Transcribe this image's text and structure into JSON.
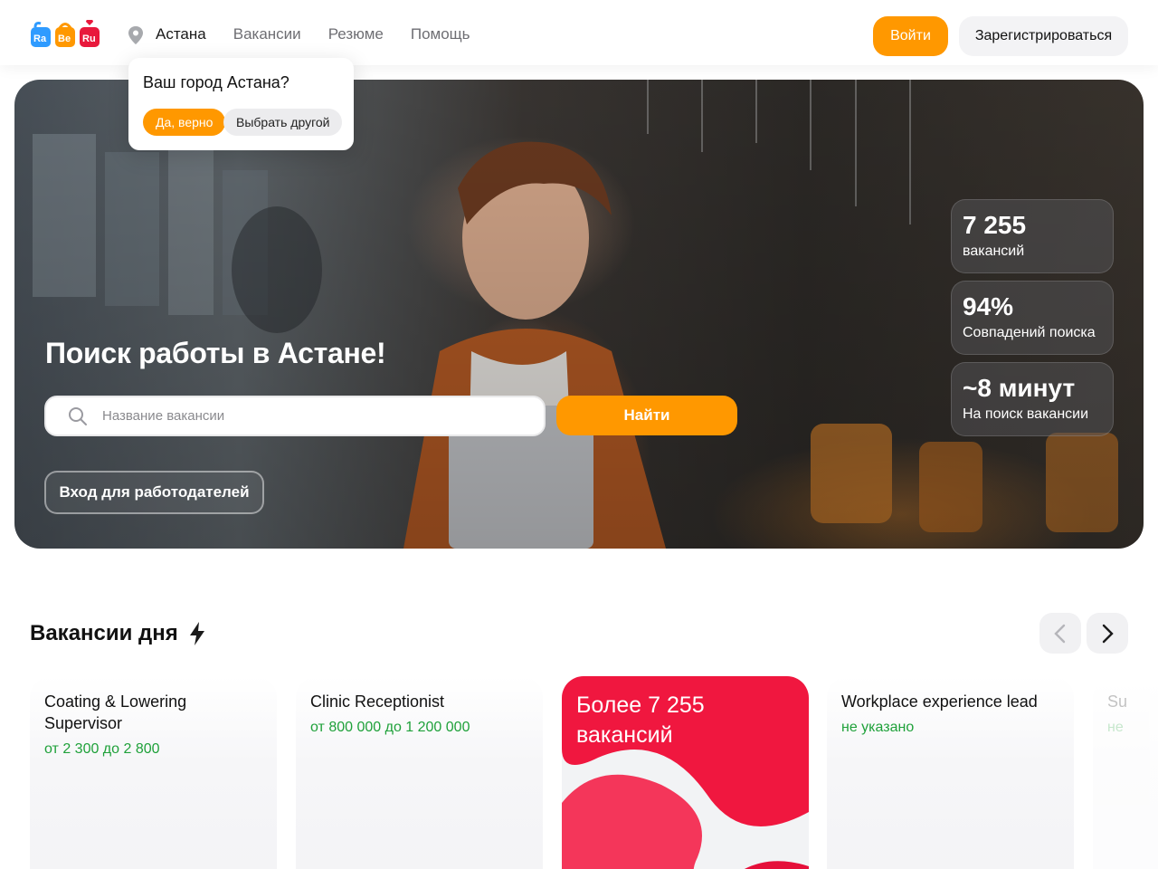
{
  "header": {
    "logo": {
      "parts": [
        "Ra",
        "Be",
        "Ru"
      ],
      "colors": [
        "#2f9bff",
        "#ff9800",
        "#e8193c"
      ]
    },
    "location_icon": "map-pin-icon",
    "nav": [
      "Астана",
      "Вакансии",
      "Резюме",
      "Помощь"
    ],
    "login_label": "Войти",
    "register_label": "Зарегистрироваться"
  },
  "city_popup": {
    "question": "Ваш город Астана?",
    "confirm_label": "Да, верно",
    "choose_label": "Выбрать другой"
  },
  "hero": {
    "title": "Поиск работы в Астане!",
    "search_placeholder": "Название вакансии",
    "search_icon": "search-icon",
    "find_label": "Найти",
    "employer_label": "Вход для работодателей",
    "stats": [
      {
        "value": "7 255",
        "label": "вакансий"
      },
      {
        "value": "94%",
        "label": "Совпадений поиска"
      },
      {
        "value": "~8 минут",
        "label": "На поиск вакансии"
      }
    ]
  },
  "vacancies": {
    "title": "Вакансии дня",
    "title_icon": "lightning-icon",
    "prev_icon": "chevron-left-icon",
    "next_icon": "chevron-right-icon",
    "cards": [
      {
        "title": "Coating & Lowering Supervisor",
        "salary": "от 2 300 до 2 800"
      },
      {
        "title": "Clinic Receptionist",
        "salary": "от 800 000 до 1 200 000"
      },
      {
        "promo": "Более 7 255 вакансий"
      },
      {
        "title": "Workplace experience lead",
        "salary": "не указано"
      },
      {
        "title": "Su",
        "salary": "не"
      }
    ]
  },
  "colors": {
    "accent": "#ff9800",
    "salary": "#1fa13a",
    "promo": "#e8193c"
  }
}
